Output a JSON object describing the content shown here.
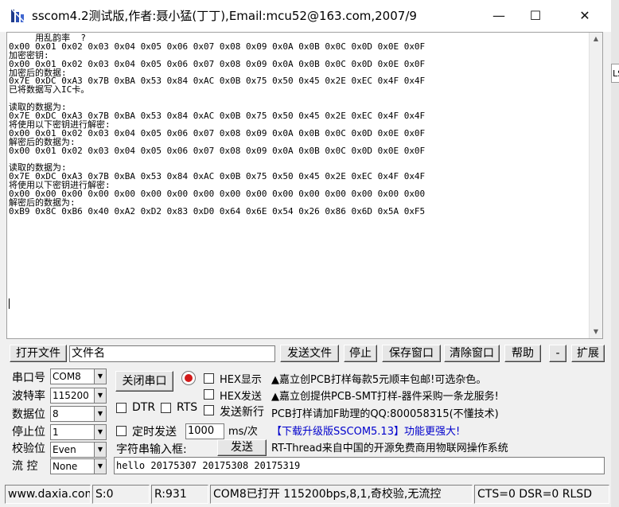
{
  "window": {
    "title": "sscom4.2测试版,作者:聂小猛(丁丁),Email:mcu52@163.com,2007/9"
  },
  "terminal": {
    "lines": [
      "     用乱韵率  ?",
      "0x00 0x01 0x02 0x03 0x04 0x05 0x06 0x07 0x08 0x09 0x0A 0x0B 0x0C 0x0D 0x0E 0x0F",
      "加密密钥:",
      "0x00 0x01 0x02 0x03 0x04 0x05 0x06 0x07 0x08 0x09 0x0A 0x0B 0x0C 0x0D 0x0E 0x0F",
      "加密后的数据:",
      "0x7E 0xDC 0xA3 0x7B 0xBA 0x53 0x84 0xAC 0x0B 0x75 0x50 0x45 0x2E 0xEC 0x4F 0x4F",
      "已将数据写入IC卡。",
      "",
      "读取的数据为:",
      "0x7E 0xDC 0xA3 0x7B 0xBA 0x53 0x84 0xAC 0x0B 0x75 0x50 0x45 0x2E 0xEC 0x4F 0x4F",
      "将使用以下密钥进行解密:",
      "0x00 0x01 0x02 0x03 0x04 0x05 0x06 0x07 0x08 0x09 0x0A 0x0B 0x0C 0x0D 0x0E 0x0F",
      "解密后的数据为:",
      "0x00 0x01 0x02 0x03 0x04 0x05 0x06 0x07 0x08 0x09 0x0A 0x0B 0x0C 0x0D 0x0E 0x0F",
      "",
      "读取的数据为:",
      "0x7E 0xDC 0xA3 0x7B 0xBA 0x53 0x84 0xAC 0x0B 0x75 0x50 0x45 0x2E 0xEC 0x4F 0x4F",
      "将使用以下密钥进行解密:",
      "0x00 0x00 0x00 0x00 0x00 0x00 0x00 0x00 0x00 0x00 0x00 0x00 0x00 0x00 0x00 0x00",
      "解密后的数据为:",
      "0xB9 0x8C 0xB6 0x40 0xA2 0xD2 0x83 0xD0 0x64 0x6E 0x54 0x26 0x86 0x6D 0x5A 0xF5"
    ]
  },
  "filebar": {
    "open_file": "打开文件",
    "filename": "文件名",
    "send_file": "发送文件",
    "stop": "停止",
    "save_window": "保存窗口",
    "clear_window": "清除窗口",
    "help": "帮助",
    "minus": "-",
    "expand": "扩展"
  },
  "settings": {
    "port_label": "串口号",
    "port_value": "COM8",
    "baud_label": "波特率",
    "baud_value": "115200",
    "databits_label": "数据位",
    "databits_value": "8",
    "stopbits_label": "停止位",
    "stopbits_value": "1",
    "parity_label": "校验位",
    "parity_value": "Even",
    "flow_label": "流 控",
    "flow_value": "None"
  },
  "controls": {
    "close_port": "关闭串口",
    "hex_display": "HEX显示",
    "hex_send": "HEX发送",
    "send_newline": "发送新行",
    "dtr": "DTR",
    "rts": "RTS",
    "timed_send": "定时发送",
    "interval_value": "1000",
    "interval_unit": "ms/次",
    "input_label": "字符串输入框:",
    "send_button": "发送",
    "send_text": "hello 20175307 20175308 20175319"
  },
  "ads": [
    "▲嘉立创PCB打样每款5元顺丰包邮!可选杂色。",
    "▲嘉立创提供PCB-SMT打样-器件采购一条龙服务!",
    "PCB打样请加F助理的QQ:800058315(不懂技术)",
    "【下载升级版SSCOM5.13】功能更强大!",
    "RT-Thread来自中国的开源免费商用物联网操作系统"
  ],
  "status": {
    "website": "www.daxia.com",
    "sent": "S:0",
    "received": "R:931",
    "port_status": "COM8已打开  115200bps,8,1,奇校验,无流控",
    "signals": "CTS=0 DSR=0 RLSD"
  },
  "colors": {
    "ad_link": "#0000cc",
    "record": "#d21a1a"
  }
}
